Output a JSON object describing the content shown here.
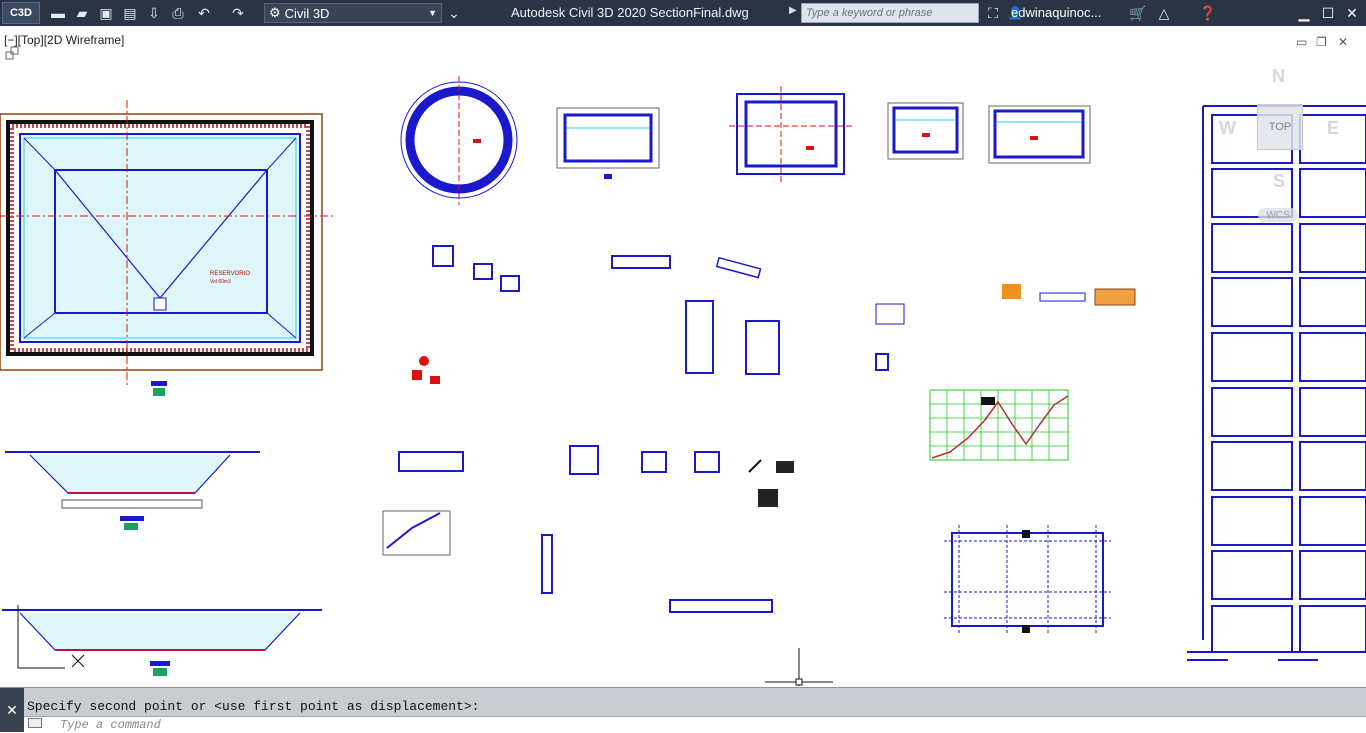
{
  "titlebar": {
    "app_button": "C3D",
    "workspace": "Civil 3D",
    "title": "Autodesk Civil 3D 2020    SectionFinal.dwg",
    "search_placeholder": "Type a keyword or phrase",
    "user": "edwinaquinoc...",
    "icons": [
      "new-icon",
      "open-icon",
      "save-icon",
      "saveas-icon",
      "import-icon",
      "print-icon",
      "undo-icon",
      "redo-icon",
      "gear-icon",
      "binoculars-icon",
      "user-icon",
      "cart-icon",
      "autodesk-icon",
      "help-icon"
    ]
  },
  "viewport": {
    "label": "[−][Top][2D Wireframe]"
  },
  "viewcube": {
    "north": "N",
    "south": "S",
    "east": "E",
    "west": "W",
    "top": "TOP",
    "wcs": "WCS"
  },
  "drawing": {
    "reservoir_label": "RESERVORIO",
    "reservoir_volume": "Vol:60m3"
  },
  "command": {
    "history": "Specify second point or <use first point as displacement>:",
    "placeholder": "Type a command"
  },
  "colors": {
    "titlebar": "#2b3445",
    "drawing_blue": "#1a1acc",
    "hatch_cyan": "#22d4e6",
    "axis_red": "#e01010",
    "grid_green": "#22cc22"
  }
}
